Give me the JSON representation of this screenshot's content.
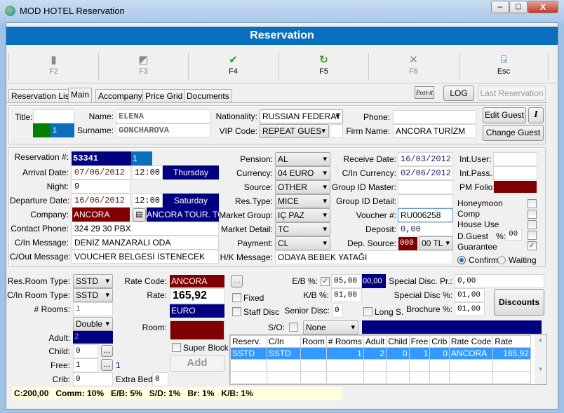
{
  "window": {
    "title": "MOD HOTEL Reservation",
    "header": "Reservation"
  },
  "toolbar": [
    {
      "icon": "new-document-icon",
      "key": "F2",
      "enabled": false
    },
    {
      "icon": "edit-document-icon",
      "key": "F3",
      "enabled": false
    },
    {
      "icon": "checkmark-icon",
      "key": "F4",
      "enabled": true
    },
    {
      "icon": "refresh-icon",
      "key": "F5",
      "enabled": true
    },
    {
      "icon": "delete-x-icon",
      "key": "F6",
      "enabled": false
    },
    {
      "icon": "exit-door-icon",
      "key": "Esc",
      "enabled": true
    }
  ],
  "tabs": [
    {
      "label": "Reservation List"
    },
    {
      "label": "Main",
      "selected": true
    },
    {
      "label": "Accompany"
    },
    {
      "label": "Price Grid"
    },
    {
      "label": "Documents"
    }
  ],
  "top_buttons": {
    "postit": "Post-it",
    "log": "LOG",
    "last_reservation": "Last Reservation"
  },
  "guest": {
    "title_label": "Title:",
    "title_value": "",
    "title_counter": "1",
    "name_label": "Name:",
    "name": "ELENA",
    "surname_label": "Surname:",
    "surname": "GONCHAROVA",
    "nationality_label": "Nationality:",
    "nationality": "RUSSIAN FEDERAT",
    "vip_label": "VIP Code:",
    "vip": "REPEAT GUES",
    "phone_label": "Phone:",
    "phone": "",
    "firm_label": "Firm Name:",
    "firm": "ANCORA TURİZM",
    "edit_guest": "Edit Guest",
    "info_button": "I",
    "change_guest": "Change Guest"
  },
  "reservation": {
    "res_no_label": "Reservation #:",
    "res_no": "53341",
    "res_sub": "1",
    "arrival_label": "Arrival Date:",
    "arrival_date": "07/06/2012",
    "arrival_time": "12:00",
    "arrival_day": "Thursday",
    "night_label": "Night:",
    "night": "9",
    "departure_label": "Departure Date:",
    "departure_date": "16/06/2012",
    "departure_time": "12:00",
    "departure_day": "Saturday",
    "company_label": "Company:",
    "company_code": "ANCORA",
    "company_name": "ANCORA TOUR. TOR",
    "contact_label": "Contact Phone:",
    "contact": "324 29 30 PBX",
    "cin_msg_label": "C/In Message:",
    "cin_msg": "DENİZ MANZARALI ODA",
    "cout_msg_label": "C/Out Message:",
    "cout_msg": "VOUCHER BELGESİ İSTENECEK",
    "pension_label": "Pension:",
    "pension": "AL",
    "currency_label": "Currency:",
    "currency": "04 EURO",
    "source_label": "Source:",
    "source": "OTHER",
    "restype_label": "Res.Type:",
    "restype": "MICE",
    "mgroup_label": "Market Group:",
    "mgroup": "IÇ PAZ",
    "mdetail_label": "Market Detail:",
    "mdetail": "TC",
    "payment_label": "Payment:",
    "payment": "CL",
    "hk_label": "H/K Message:",
    "hk": "ODAYA BEBEK YATAĞI",
    "receive_label": "Receive Date:",
    "receive": "16/03/2012",
    "cincur_label": "C/In Currency:",
    "cincur": "02/06/2012",
    "gmaster_label": "Group ID Master:",
    "gmaster": "",
    "gdetail_label": "Group ID Detail:",
    "gdetail": "",
    "voucher_label": "Voucher #:",
    "voucher": "RU006258",
    "deposit_label": "Deposit:",
    "deposit": "0,00",
    "depsrc_label": "Dep. Source:",
    "depsrc_code": "000",
    "depsrc_cur": "00 TL",
    "intuser_label": "Int.User:",
    "intpass_label": "Int.Pass.:",
    "pmfolio_label": "PM Folio:",
    "honeymoon": "Honeymoon",
    "comp": "Comp",
    "house_use": "House Use",
    "dguest": "D.Guest",
    "pct_label": "%:",
    "dguest_pct": "00",
    "guarantee": "Guarantee",
    "flags": {
      "honeymoon": false,
      "comp": false,
      "house_use": false,
      "dguest": false,
      "guarantee": true
    },
    "confirm": "Confirm",
    "waiting": "Waiting",
    "status": "Confirm"
  },
  "room": {
    "resroom_label": "Res.Room Type:",
    "resroom": "SSTD",
    "cinroom_label": "C/In Room Type:",
    "cinroom": "SSTD",
    "rooms_label": "# Rooms:",
    "rooms": "1",
    "bedtype": "Double",
    "adult_label": "Adult:",
    "adult": "2",
    "child_label": "Child:",
    "child": "0",
    "free_label": "Free:",
    "free": "1",
    "free_count": "1",
    "crib_label": "Crib:",
    "crib": "0",
    "extrabed_label": "Extra Bed:",
    "extrabed": "0",
    "ratecode_label": "Rate Code:",
    "ratecode": "ANCORA",
    "rate_label": "Rate:",
    "rate": "165,92",
    "rate_currency": "EURO",
    "room_label": "Room:",
    "fixed": "Fixed",
    "staff_disc": "Staff Disc",
    "super_block": "Super Block",
    "add": "Add",
    "eb_label": "E/B %:",
    "eb": "05,00",
    "eb_amount": "00,00",
    "eb_checked": true,
    "kb_label": "K/B %:",
    "kb": "01,00",
    "senior_label": "Senior Disc:",
    "senior": "0",
    "long_stay": "Long S.",
    "sdpr_label": "Special Disc. Pr.:",
    "sdpr": "0,00",
    "sdpct_label": "Special Disc %:",
    "sdpct": "01,00",
    "brochure_label": "Brochure %:",
    "brochure": "01,00",
    "discounts": "Discounts",
    "so_label": "S/O:",
    "so": "None"
  },
  "grid": {
    "columns": [
      "Reserv.",
      "C/In",
      "Room",
      "# Rooms",
      "Adult",
      "Child",
      "Free",
      "Crib",
      "Rate Code",
      "Rate"
    ],
    "rows": [
      [
        "SSTD",
        "SSTD",
        "",
        "1",
        "2",
        "0",
        "1",
        "0",
        "ANCORA",
        "165,92"
      ]
    ]
  },
  "statusbar": "C:200,00   Comm: 10%   E/B: 5%   S/D: 1%   Br: 1%   K/B: 1%",
  "colors": {
    "header": "#0a6fbd",
    "navy": "#000080",
    "maroon": "#800000",
    "selection": "#3399ff"
  }
}
